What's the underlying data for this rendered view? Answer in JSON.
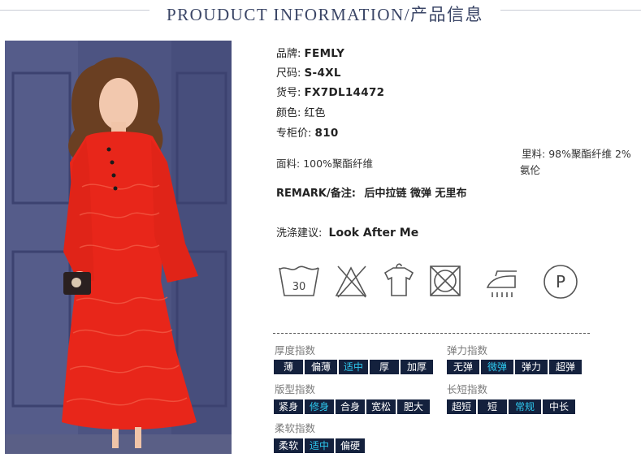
{
  "header": {
    "title": "PROUDUCT INFORMATION/产品信息"
  },
  "specs": [
    {
      "label": "品牌:",
      "value": "FEMLY"
    },
    {
      "label": "尺码:",
      "value": "S-4XL"
    },
    {
      "label": "货号:",
      "value": "FX7DL14472"
    },
    {
      "label": "颜色:",
      "value": "红色"
    },
    {
      "label": "专柜价:",
      "value": "810"
    }
  ],
  "fabric": {
    "label": "面料:",
    "value": "100%聚酯纤维"
  },
  "lining": {
    "label": "里料:",
    "value": "98%聚酯纤维 2%氨伦"
  },
  "remark": {
    "label": "REMARK/备注:",
    "value": "后中拉链 微弹 无里布"
  },
  "wash": {
    "label": "洗涤建议:",
    "value": "Look After Me"
  },
  "care_icons": [
    {
      "name": "wash-30-icon",
      "text": "30"
    },
    {
      "name": "no-bleach-icon"
    },
    {
      "name": "hang-dry-icon"
    },
    {
      "name": "no-tumble-dry-icon"
    },
    {
      "name": "iron-icon"
    },
    {
      "name": "dry-clean-p-icon",
      "text": "P"
    }
  ],
  "indexes": {
    "thickness": {
      "title": "厚度指数",
      "options": [
        "薄",
        "偏薄",
        "适中",
        "厚",
        "加厚"
      ],
      "selected": 2
    },
    "elasticity": {
      "title": "弹力指数",
      "options": [
        "无弹",
        "微弹",
        "弹力",
        "超弹"
      ],
      "selected": 1
    },
    "fit": {
      "title": "版型指数",
      "options": [
        "紧身",
        "修身",
        "合身",
        "宽松",
        "肥大"
      ],
      "selected": 1
    },
    "length": {
      "title": "长短指数",
      "options": [
        "超短",
        "短",
        "常规",
        "中长"
      ],
      "selected": 2
    },
    "softness": {
      "title": "柔软指数",
      "options": [
        "柔软",
        "适中",
        "偏硬"
      ],
      "selected": 1
    }
  },
  "colors": {
    "accent": "#2ec9f0",
    "bar": "#14213d",
    "dress": "#e8261a",
    "title": "#3a4566"
  }
}
